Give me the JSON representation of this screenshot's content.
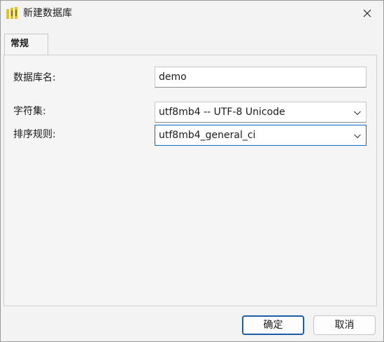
{
  "window": {
    "title": "新建数据库"
  },
  "tabs": [
    {
      "label": "常规"
    }
  ],
  "form": {
    "db_name_label": "数据库名:",
    "db_name_value": "demo",
    "charset_label": "字符集:",
    "charset_value": "utf8mb4 -- UTF-8 Unicode",
    "collation_label": "排序规则:",
    "collation_value": "utf8mb4_general_ci"
  },
  "buttons": {
    "ok": "确定",
    "cancel": "取消"
  },
  "colors": {
    "accent": "#0b6ec7",
    "app_icon": "#e3c31f"
  }
}
